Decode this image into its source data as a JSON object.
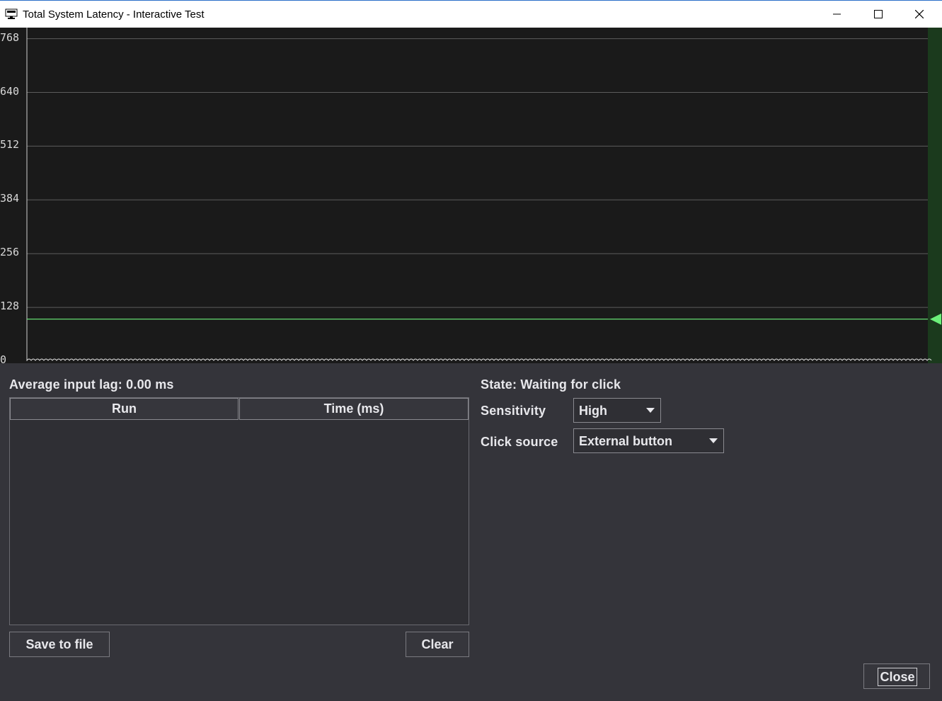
{
  "window": {
    "title": "Total System Latency - Interactive Test",
    "icon": "app-monitor-icon",
    "controls": [
      "minimize-icon",
      "maximize-icon",
      "close-icon"
    ]
  },
  "chart_data": {
    "type": "line",
    "yticks": [
      "768",
      "640",
      "512",
      "384",
      "256",
      "128",
      "0"
    ],
    "ylim": [
      0,
      800
    ],
    "threshold": 100,
    "threshold_color": "#6cf07a",
    "grid": true,
    "background": "#1a1a1a"
  },
  "summary": {
    "avg_label": "Average input lag: 0.00 ms"
  },
  "table": {
    "columns": [
      "Run",
      "Time (ms)"
    ],
    "rows": []
  },
  "buttons": {
    "save": "Save to file",
    "clear": "Clear",
    "close": "Close"
  },
  "state": {
    "label": "State: Waiting for click"
  },
  "settings": {
    "sensitivity_label": "Sensitivity",
    "sensitivity_value": "High",
    "click_source_label": "Click source",
    "click_source_value": "External button"
  },
  "colors": {
    "accent_green": "#6cf07a",
    "panel_bg": "#34343a",
    "graph_bg": "#1a1a1a"
  }
}
